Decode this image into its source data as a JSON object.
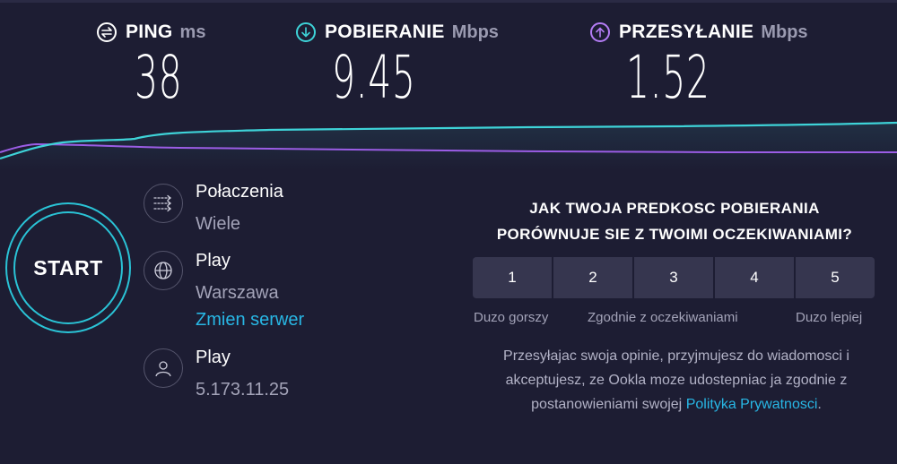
{
  "metrics": {
    "ping": {
      "label": "PING",
      "unit": "ms",
      "value": "38"
    },
    "download": {
      "label": "POBIERANIE",
      "unit": "Mbps",
      "value": "9.45"
    },
    "upload": {
      "label": "PRZESYŁANIE",
      "unit": "Mbps",
      "value": "1.52"
    }
  },
  "graph": {
    "download_color": "#3ed3d8",
    "upload_color": "#9b5de5"
  },
  "start_button": {
    "label": "START",
    "accent": "#2ac3d6"
  },
  "info": {
    "connections": {
      "icon": "connections-arrows-icon",
      "title": "Połaczenia",
      "value": "Wiele"
    },
    "server": {
      "icon": "globe-icon",
      "title": "Play",
      "value": "Warszawa",
      "change_link": "Zmien serwer"
    },
    "provider": {
      "icon": "user-icon",
      "title": "Play",
      "value": "5.173.11.25"
    }
  },
  "survey": {
    "question_line1": "JAK TWOJA PREDKOSC POBIERANIA",
    "question_line2": "PORÓWNUJE SIE Z TWOIMI OCZEKIWANIAMI?",
    "options": [
      "1",
      "2",
      "3",
      "4",
      "5"
    ],
    "scale_low": "Duzo gorszy",
    "scale_mid": "Zgodnie z oczekiwaniami",
    "scale_high": "Duzo lepiej",
    "disclaimer": "Przesyłajac swoja opinie, przyjmujesz do wiadomosci i akceptujesz, ze Ookla moze udostepniac ja zgodnie z postanowieniami swojej",
    "privacy_link": "Polityka Prywatnosci",
    "period": "."
  }
}
